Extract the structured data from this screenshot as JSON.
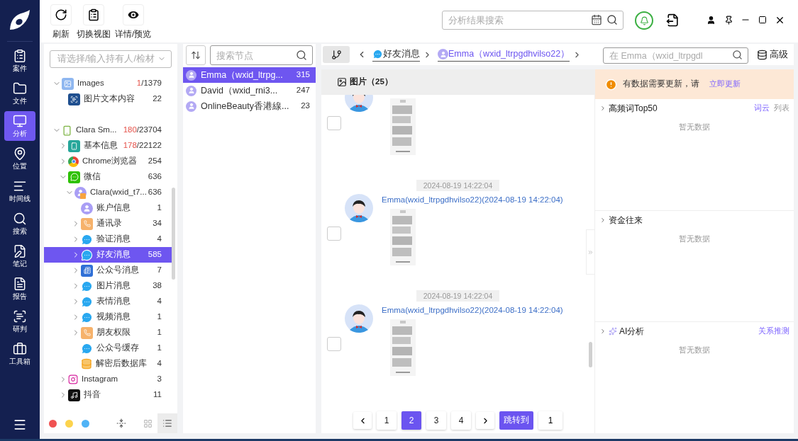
{
  "nav": {
    "items": [
      {
        "label": "案件",
        "kind": "case",
        "selected": false
      },
      {
        "label": "文件",
        "kind": "folder",
        "selected": false
      },
      {
        "label": "分析",
        "kind": "analysis",
        "selected": true
      },
      {
        "label": "位置",
        "kind": "location",
        "selected": false
      },
      {
        "label": "时间线",
        "kind": "timeline",
        "selected": false
      },
      {
        "label": "搜索",
        "kind": "search",
        "selected": false
      },
      {
        "label": "笔记",
        "kind": "note",
        "selected": false
      },
      {
        "label": "报告",
        "kind": "report",
        "selected": false
      },
      {
        "label": "研判",
        "kind": "judge",
        "selected": false
      },
      {
        "label": "工具箱",
        "kind": "toolbox",
        "selected": false
      }
    ]
  },
  "toolbar": {
    "buttons": [
      {
        "label": "刷新",
        "kind": "refresh"
      },
      {
        "label": "切换视图",
        "kind": "view"
      },
      {
        "label": "详情/预览",
        "kind": "eye"
      }
    ],
    "search": {
      "placeholder": "分析结果搜索"
    }
  },
  "tree": {
    "owner_select": {
      "placeholder": "请选择/输入持有人/检材"
    },
    "items": [
      {
        "label": "Images",
        "kind": "images",
        "count_new": "1",
        "count": "/1379",
        "expandable": true,
        "expanded": true,
        "selected": false,
        "children": [
          {
            "label": "图片文本内容",
            "kind": "ocr",
            "count": "22",
            "expandable": false,
            "selected": false
          }
        ]
      },
      {
        "label": "Clara Sm...",
        "kind": "android",
        "count_new": "180",
        "count": "/23704",
        "expandable": true,
        "expanded": true,
        "selected": false,
        "children": [
          {
            "label": "基本信息",
            "kind": "info",
            "count_new": "178",
            "count": "/22122",
            "expandable": true,
            "expanded": false,
            "selected": false
          },
          {
            "label": "Chrome浏览器",
            "kind": "chrome",
            "count": "254",
            "expandable": true,
            "expanded": false,
            "selected": false
          },
          {
            "label": "微信",
            "kind": "wechat",
            "count": "636",
            "expandable": true,
            "expanded": true,
            "selected": false,
            "children": [
              {
                "label": "Clara(wxid_t7...",
                "kind": "account",
                "count": "636",
                "expandable": true,
                "expanded": true,
                "selected": false,
                "children": [
                  {
                    "label": "账户信息",
                    "kind": "user",
                    "count": "1",
                    "expandable": false,
                    "selected": false
                  },
                  {
                    "label": "通讯录",
                    "kind": "contacts",
                    "count": "34",
                    "expandable": true,
                    "expanded": false,
                    "selected": false
                  },
                  {
                    "label": "验证消息",
                    "kind": "chat",
                    "count": "4",
                    "expandable": true,
                    "expanded": false,
                    "selected": false
                  },
                  {
                    "label": "好友消息",
                    "kind": "chat",
                    "count": "585",
                    "expandable": true,
                    "expanded": false,
                    "selected": true
                  },
                  {
                    "label": "公众号消息",
                    "kind": "official",
                    "count": "7",
                    "expandable": true,
                    "expanded": false,
                    "selected": false
                  },
                  {
                    "label": "图片消息",
                    "kind": "chat",
                    "count": "38",
                    "expandable": true,
                    "expanded": false,
                    "selected": false
                  },
                  {
                    "label": "表情消息",
                    "kind": "chat",
                    "count": "4",
                    "expandable": true,
                    "expanded": false,
                    "selected": false
                  },
                  {
                    "label": "视频消息",
                    "kind": "chat",
                    "count": "1",
                    "expandable": true,
                    "expanded": false,
                    "selected": false
                  },
                  {
                    "label": "朋友权限",
                    "kind": "contacts",
                    "count": "1",
                    "expandable": true,
                    "expanded": false,
                    "selected": false
                  },
                  {
                    "label": "公众号缓存",
                    "kind": "chat",
                    "count": "1",
                    "expandable": false,
                    "selected": false
                  },
                  {
                    "label": "解密后数据库",
                    "kind": "database",
                    "count": "4",
                    "expandable": false,
                    "selected": false
                  }
                ]
              }
            ]
          },
          {
            "label": "Instagram",
            "kind": "instagram",
            "count": "3",
            "expandable": true,
            "expanded": false,
            "selected": false
          },
          {
            "label": "抖音",
            "kind": "tiktok",
            "count": "11",
            "expandable": true,
            "expanded": false,
            "selected": false
          }
        ]
      }
    ],
    "color_dots": [
      {
        "color": "#f05252"
      },
      {
        "color": "#fcd34d"
      },
      {
        "color": "#4fb3f6"
      }
    ],
    "view_modes": [
      {
        "kind": "grid",
        "selected": false
      },
      {
        "kind": "list",
        "selected": true
      }
    ]
  },
  "contacts": {
    "search": {
      "placeholder": "搜索节点"
    },
    "items": [
      {
        "label": "Emma（wxid_ltrpg...",
        "count": "315",
        "selected": true
      },
      {
        "label": "David（wxid_rni3...",
        "count": "247",
        "selected": false
      },
      {
        "label": "OnlineBeauty香港線...",
        "count": "23",
        "selected": false
      }
    ]
  },
  "header": {
    "breadcrumb": [
      {
        "label": "好友消息",
        "kind": "chat"
      },
      {
        "label": "Emma（wxid_ltrpgdhvilso22）",
        "kind": "user"
      }
    ],
    "search": {
      "placeholder": "在 Emma（wxid_ltrpgdl"
    },
    "advanced": "高级"
  },
  "chat": {
    "tab": "图片（25）",
    "messages": [
      {
        "checked": false
      },
      {
        "time": "2024-08-19 14:22:04",
        "sender": "Emma(wxid_ltrpgdhvilso22)(2024-08-19 14:22:04)",
        "checked": false
      },
      {
        "time": "2024-08-19 14:22:04",
        "sender": "Emma(wxid_ltrpgdhvilso22)(2024-08-19 14:22:04)",
        "checked": false
      }
    ],
    "pagination": {
      "pages": [
        {
          "label": "1",
          "selected": false
        },
        {
          "label": "2",
          "selected": true
        },
        {
          "label": "3",
          "selected": false
        },
        {
          "label": "4",
          "selected": false
        }
      ],
      "jump_label": "跳转到",
      "jump_value": "1"
    }
  },
  "side": {
    "notice": {
      "text": "有数据需要更新，请",
      "link": "立即更新"
    },
    "sections": [
      {
        "title": "高频词Top50",
        "kind": "plain",
        "tabs": [
          {
            "label": "词云",
            "selected": true
          },
          {
            "label": "列表",
            "selected": false
          }
        ],
        "empty": "暂无数据"
      },
      {
        "title": "资金往来",
        "kind": "plain",
        "empty": "暂无数据"
      },
      {
        "title": "AI分析",
        "kind": "ai",
        "action": "关系推测",
        "empty": "暂无数据"
      }
    ]
  }
}
